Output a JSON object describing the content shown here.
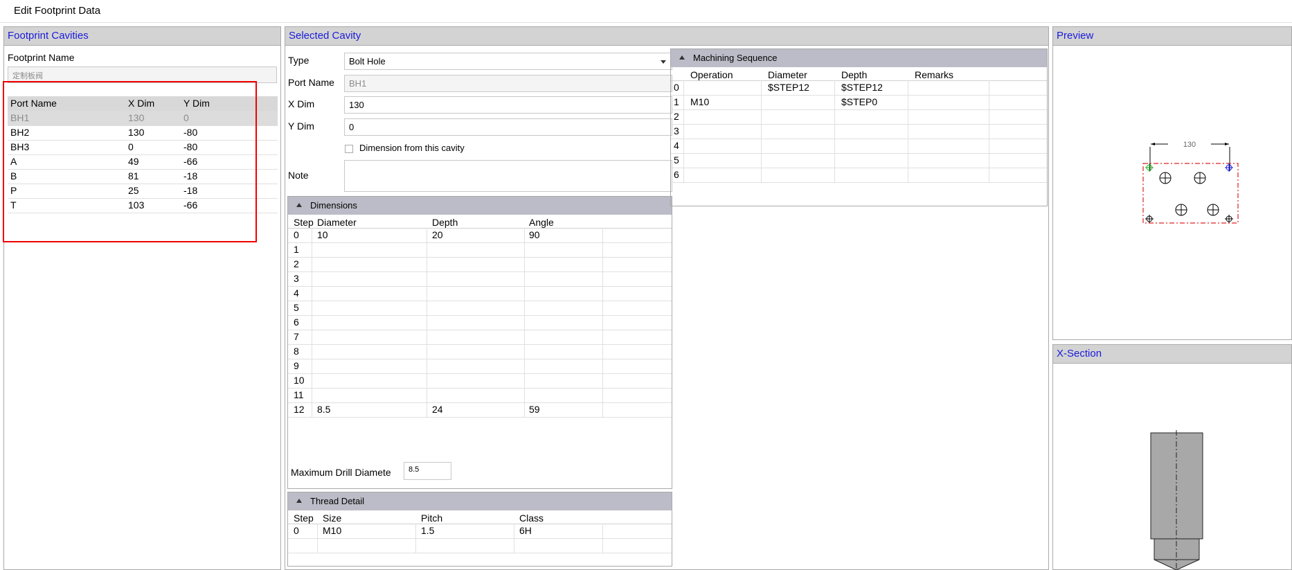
{
  "window": {
    "title": "Edit Footprint Data"
  },
  "left_panel": {
    "title": "Footprint Cavities",
    "footprint_name_label": "Footprint Name",
    "footprint_name_value": "定制板阀",
    "columns": [
      "Port Name",
      "X Dim",
      "Y Dim"
    ],
    "rows": [
      [
        "BH1",
        "130",
        "0"
      ],
      [
        "BH2",
        "130",
        "-80"
      ],
      [
        "BH3",
        "0",
        "-80"
      ],
      [
        "A",
        "49",
        "-66"
      ],
      [
        "B",
        "81",
        "-18"
      ],
      [
        "P",
        "25",
        "-18"
      ],
      [
        "T",
        "103",
        "-66"
      ]
    ],
    "selected_row": 0
  },
  "selected_cavity": {
    "title": "Selected Cavity",
    "type_label": "Type",
    "type_value": "Bolt Hole",
    "port_name_label": "Port Name",
    "port_name_value": "BH1",
    "x_dim_label": "X Dim",
    "x_dim_value": "130",
    "y_dim_label": "Y Dim",
    "y_dim_value": "0",
    "dimension_checkbox_label": "Dimension from this cavity",
    "dimension_checkbox_checked": false,
    "note_label": "Note",
    "note_value": ""
  },
  "dimensions": {
    "title": "Dimensions",
    "columns": [
      "Step",
      "Diameter",
      "Depth",
      "Angle"
    ],
    "rows": [
      [
        "0",
        "10",
        "20",
        "90"
      ],
      [
        "1",
        "",
        "",
        ""
      ],
      [
        "2",
        "",
        "",
        ""
      ],
      [
        "3",
        "",
        "",
        ""
      ],
      [
        "4",
        "",
        "",
        ""
      ],
      [
        "5",
        "",
        "",
        ""
      ],
      [
        "6",
        "",
        "",
        ""
      ],
      [
        "7",
        "",
        "",
        ""
      ],
      [
        "8",
        "",
        "",
        ""
      ],
      [
        "9",
        "",
        "",
        ""
      ],
      [
        "10",
        "",
        "",
        ""
      ],
      [
        "11",
        "",
        "",
        ""
      ],
      [
        "12",
        "8.5",
        "24",
        "59"
      ]
    ],
    "max_drill_label": "Maximum Drill Diamete",
    "max_drill_value": "8.5"
  },
  "thread_detail": {
    "title": "Thread Detail",
    "columns": [
      "Step",
      "Size",
      "Pitch",
      "Class"
    ],
    "rows": [
      [
        "0",
        "M10",
        "1.5",
        "6H"
      ],
      [
        "",
        "",
        "",
        ""
      ]
    ]
  },
  "machining_sequence": {
    "title": "Machining Sequence",
    "columns": [
      "Operation",
      "Diameter",
      "Depth",
      "Remarks"
    ],
    "rows": [
      [
        "0",
        "",
        "$STEP12",
        "$STEP12",
        ""
      ],
      [
        "1",
        "M10",
        "",
        "$STEP0",
        ""
      ],
      [
        "2",
        "",
        "",
        "",
        ""
      ],
      [
        "3",
        "",
        "",
        "",
        ""
      ],
      [
        "4",
        "",
        "",
        "",
        ""
      ],
      [
        "5",
        "",
        "",
        "",
        ""
      ],
      [
        "6",
        "",
        "",
        "",
        ""
      ]
    ]
  },
  "preview": {
    "title": "Preview",
    "dimension_text": "130"
  },
  "xsection": {
    "title": "X-Section"
  },
  "colors": {
    "panel_title": "#1a1adc",
    "highlight": "#f00000",
    "outline": "#e02020"
  }
}
